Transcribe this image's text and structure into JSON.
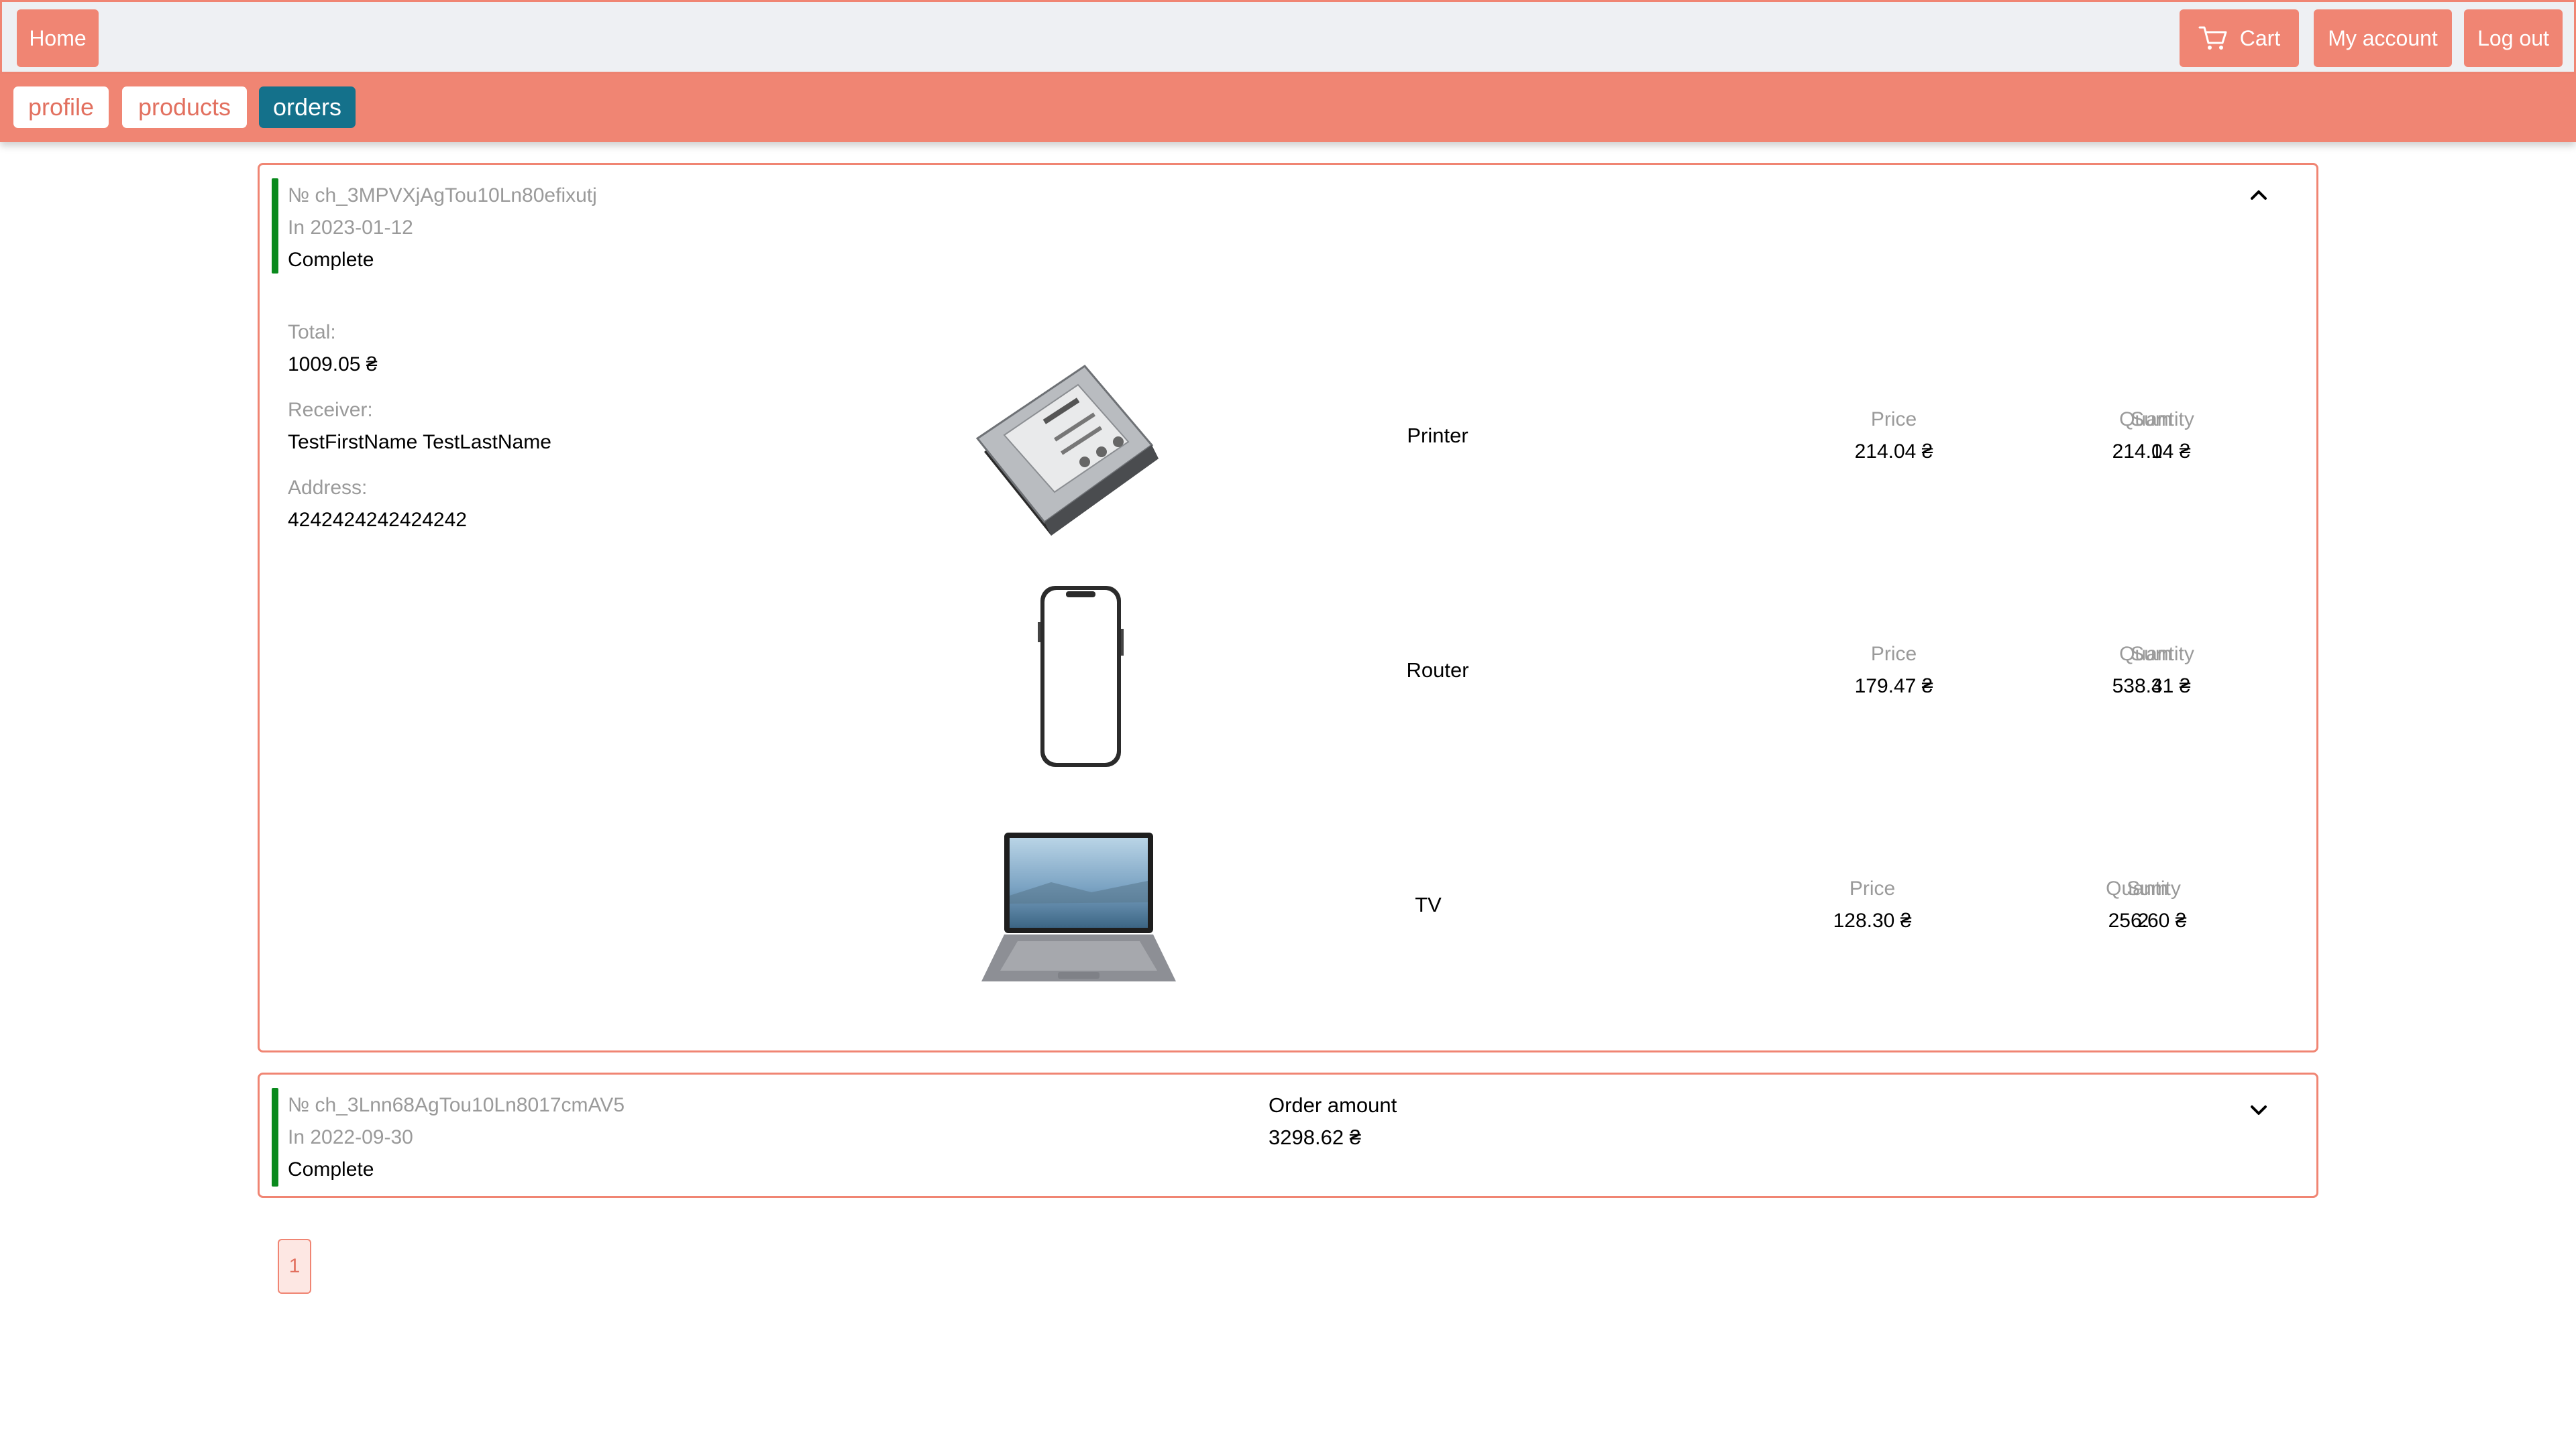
{
  "nav": {
    "home": "Home",
    "cart": "Cart",
    "account": "My account",
    "logout": "Log out"
  },
  "tabs": [
    "profile",
    "products",
    "orders"
  ],
  "colors": {
    "accent": "#f08573",
    "active_tab": "#14718b",
    "status_complete": "#0a8a1d"
  },
  "orders": [
    {
      "number": "№ ch_3MPVXjAgTou10Ln80efixutj",
      "date": "In 2023-01-12",
      "status": "Complete",
      "expanded": true,
      "details": {
        "total_label": "Total:",
        "total": "1009.05 ₴",
        "receiver_label": "Receiver:",
        "receiver": "TestFirstName TestLastName",
        "address_label": "Address:",
        "address": "4242424242424242"
      },
      "items": [
        {
          "image": "hard-drive-image",
          "name": "Printer",
          "price_label": "Price",
          "price": "214.04 ₴",
          "quantity_label": "Quantity",
          "quantity": "1",
          "sum_label": "Sum",
          "sum": "214.04 ₴"
        },
        {
          "image": "smartphone-image",
          "name": "Router",
          "price_label": "Price",
          "price": "179.47 ₴",
          "quantity_label": "Quantity",
          "quantity": "3",
          "sum_label": "Sum",
          "sum": "538.41 ₴"
        },
        {
          "image": "laptop-image",
          "name": "TV",
          "price_label": "Price",
          "price": "128.30 ₴",
          "quantity_label": "Quantity",
          "quantity": "2",
          "sum_label": "Sum",
          "sum": "256.60 ₴"
        }
      ]
    },
    {
      "number": "№ ch_3Lnn68AgTou10Ln8017cmAV5",
      "date": "In 2022-09-30",
      "status": "Complete",
      "expanded": false,
      "amount_label": "Order amount",
      "amount": "3298.62 ₴"
    }
  ],
  "pagination": {
    "current": "1"
  }
}
